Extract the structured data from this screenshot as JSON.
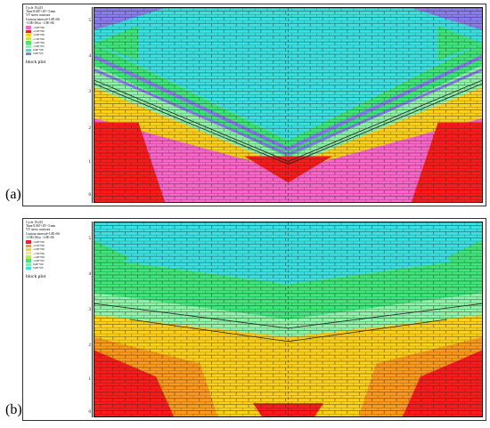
{
  "panels": [
    {
      "letter": "(a)",
      "info_lines": [
        "Cycle 19,415",
        "Time 8.067×10^-3 min",
        "YY stress contours"
      ],
      "contour_interval": "Contour interval=1.0E+06",
      "contour_range": "-3.0E+06 to -1.0E+06",
      "legend": [
        {
          "value": "-3.0E+06",
          "color": "#ff66cc"
        },
        {
          "value": "-2.5E+06",
          "color": "#ff1a1a"
        },
        {
          "value": "-2.0E+06",
          "color": "#ffd21a"
        },
        {
          "value": "-1.5E+06",
          "color": "#b6f23a"
        },
        {
          "value": "-1.0E+06",
          "color": "#3ee87a"
        },
        {
          "value": "-5.0E+05",
          "color": "#8ef5a8"
        },
        {
          "value": "0.0E+00",
          "color": "#39e3e3"
        },
        {
          "value": "5.0E+05",
          "color": "#8a7df0"
        }
      ],
      "caption": "block plot",
      "ticks": [
        "5",
        "4",
        "3",
        "2",
        "1",
        "0"
      ]
    },
    {
      "letter": "(b)",
      "info_lines": [
        "Cycle 19,415",
        "Time 8.067×10^-3 min",
        "YY stress contours"
      ],
      "contour_interval": "Contour interval=1.0E+06",
      "contour_range": "-3.0E+06 to -1.0E+06",
      "legend": [
        {
          "value": "-3.0E+06",
          "color": "#ff1a1a"
        },
        {
          "value": "-2.5E+06",
          "color": "#ff9a1a"
        },
        {
          "value": "-2.0E+06",
          "color": "#ffd21a"
        },
        {
          "value": "-1.5E+06",
          "color": "#f2f23a"
        },
        {
          "value": "-1.0E+06",
          "color": "#b6f23a"
        },
        {
          "value": "-5.0E+05",
          "color": "#3ee87a"
        },
        {
          "value": "0.0E+00",
          "color": "#7df0b0"
        },
        {
          "value": "5.0E+05",
          "color": "#39e3e3"
        }
      ],
      "caption": "block plot",
      "ticks": [
        "5",
        "4",
        "3",
        "2",
        "1",
        "0"
      ]
    }
  ],
  "colors": {
    "a": {
      "top": "#39e3e3",
      "mid": "#3ee87a",
      "light": "#8ef5a8",
      "yellow": "#ffd21a",
      "red": "#ff1a1a",
      "pink": "#ff66cc",
      "purple": "#8a7df0"
    },
    "b": {
      "top": "#39e3e3",
      "green": "#3ee87a",
      "light": "#8ef5a8",
      "yellow": "#ffd21a",
      "orange": "#ff9a1a",
      "red": "#ff1a1a"
    }
  }
}
